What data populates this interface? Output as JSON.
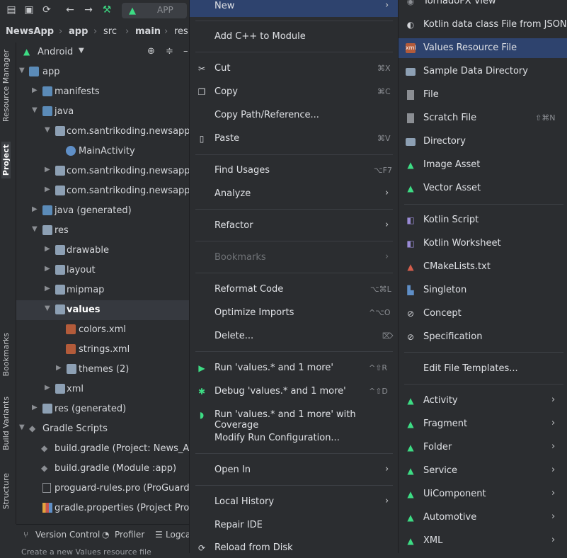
{
  "toolbar": {
    "run_config_label": "APP"
  },
  "breadcrumb": [
    "NewsApp",
    "app",
    "src",
    "main",
    "res"
  ],
  "left_strip": {
    "resource_manager": "Resource Manager",
    "project": "Project",
    "bookmarks": "Bookmarks",
    "build_variants": "Build Variants",
    "structure": "Structure"
  },
  "project": {
    "view_selector": "Android",
    "tree": [
      {
        "label": "app",
        "depth": 0
      },
      {
        "label": "manifests",
        "depth": 1
      },
      {
        "label": "java",
        "depth": 1
      },
      {
        "label": "com.santrikoding.newsapp",
        "depth": 2
      },
      {
        "label": "MainActivity",
        "depth": 3
      },
      {
        "label": "com.santrikoding.newsapp (a",
        "depth": 2
      },
      {
        "label": "com.santrikoding.newsapp (te",
        "depth": 2
      },
      {
        "label": "java (generated)",
        "depth": 1
      },
      {
        "label": "res",
        "depth": 1
      },
      {
        "label": "drawable",
        "depth": 2
      },
      {
        "label": "layout",
        "depth": 2
      },
      {
        "label": "mipmap",
        "depth": 2
      },
      {
        "label": "values",
        "depth": 2
      },
      {
        "label": "colors.xml",
        "depth": 3
      },
      {
        "label": "strings.xml",
        "depth": 3
      },
      {
        "label": "themes (2)",
        "depth": 3
      },
      {
        "label": "xml",
        "depth": 2
      },
      {
        "label": "res (generated)",
        "depth": 1
      },
      {
        "label": "Gradle Scripts",
        "depth": 0
      },
      {
        "label": "build.gradle (Project: News_App)",
        "depth": 1
      },
      {
        "label": "build.gradle (Module :app)",
        "depth": 1
      },
      {
        "label": "proguard-rules.pro (ProGuard Ru",
        "depth": 1
      },
      {
        "label": "gradle.properties (Project Prope",
        "depth": 1
      }
    ]
  },
  "bottom_tabs": {
    "version_control": "Version Control",
    "profiler": "Profiler",
    "logcat": "Logca"
  },
  "status": "Create a new Values resource file",
  "context_menu": {
    "new": "New",
    "add_cpp": "Add C++ to Module",
    "cut": "Cut",
    "cut_sc": "⌘X",
    "copy": "Copy",
    "copy_sc": "⌘C",
    "copy_path": "Copy Path/Reference...",
    "paste": "Paste",
    "paste_sc": "⌘V",
    "find_usages": "Find Usages",
    "find_usages_sc": "⌥F7",
    "analyze": "Analyze",
    "refactor": "Refactor",
    "bookmarks": "Bookmarks",
    "reformat": "Reformat Code",
    "reformat_sc": "⌥⌘L",
    "optimize": "Optimize Imports",
    "optimize_sc": "^⌥O",
    "delete": "Delete...",
    "delete_sc": "⌦",
    "run": "Run 'values.* and 1 more'",
    "run_sc": "^⇧R",
    "debug": "Debug 'values.* and 1 more'",
    "debug_sc": "^⇧D",
    "run_cov": "Run 'values.* and 1 more' with Coverage",
    "modify_run": "Modify Run Configuration...",
    "open_in": "Open In",
    "local_history": "Local History",
    "repair_ide": "Repair IDE",
    "reload": "Reload from Disk"
  },
  "submenu": {
    "tornadofx": "TornadoFX View",
    "kotlin_data": "Kotlin data class File from JSON",
    "values_resource": "Values Resource File",
    "sample_data": "Sample Data Directory",
    "file": "File",
    "scratch": "Scratch File",
    "scratch_sc": "⇧⌘N",
    "directory": "Directory",
    "image_asset": "Image Asset",
    "vector_asset": "Vector Asset",
    "kotlin_script": "Kotlin Script",
    "kotlin_worksheet": "Kotlin Worksheet",
    "cmake": "CMakeLists.txt",
    "singleton": "Singleton",
    "concept": "Concept",
    "specification": "Specification",
    "edit_templates": "Edit File Templates...",
    "activity": "Activity",
    "fragment": "Fragment",
    "folder": "Folder",
    "service": "Service",
    "uicomponent": "UiComponent",
    "automotive": "Automotive",
    "xml": "XML"
  },
  "colors": {
    "highlight": "#2e436e",
    "android_green": "#3ddc84"
  }
}
